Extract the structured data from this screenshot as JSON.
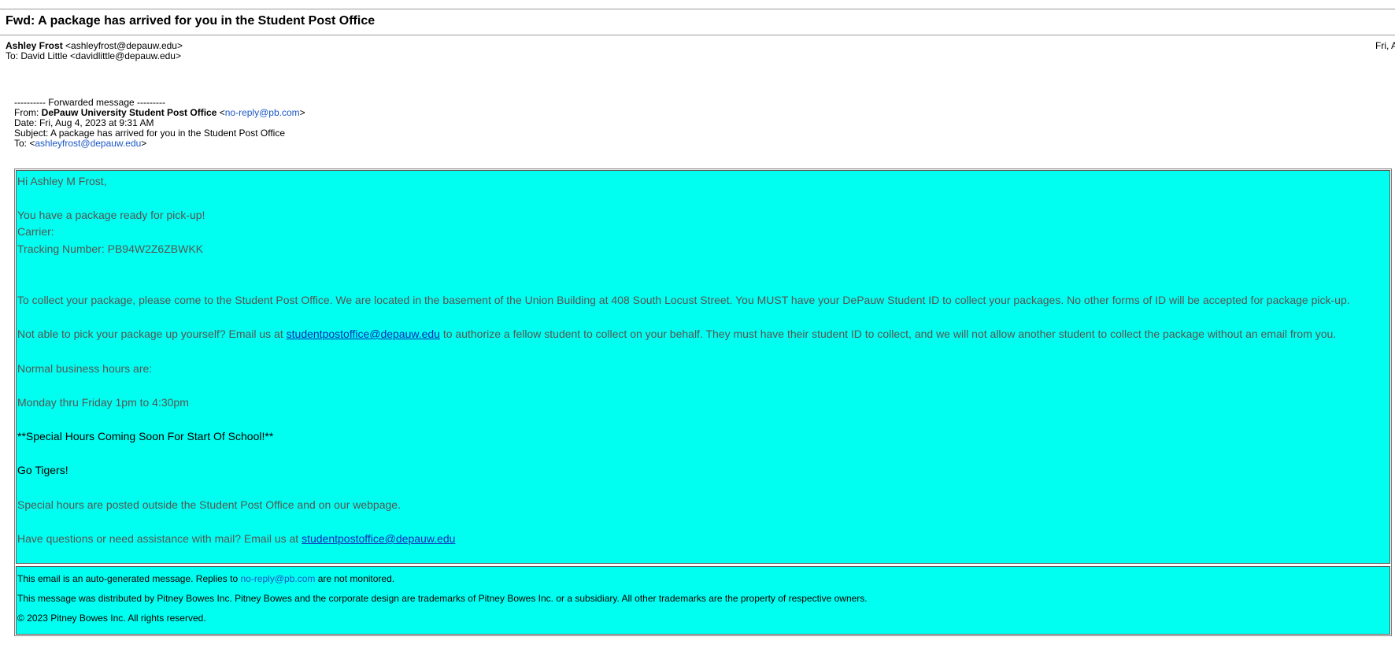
{
  "email": {
    "subject": "Fwd: A package has arrived for you in the Student Post Office",
    "from_name": "Ashley Frost",
    "from_addr": "<ashleyfrost@depauw.edu>",
    "to_line": "To: David Little <davidlittle@depauw.edu>",
    "date_short": "Fri, A"
  },
  "forwarded": {
    "separator": "---------- Forwarded message ---------",
    "from_label": "From: ",
    "from_name": "DePauw University Student Post Office",
    "from_open": " <",
    "from_email": "no-reply@pb.com",
    "from_close": ">",
    "date": "Date: Fri, Aug 4, 2023 at 9:31 AM",
    "subject": "Subject: A package has arrived for you in the Student Post Office",
    "to_label": "To: <",
    "to_email": "ashleyfrost@depauw.edu",
    "to_close": ">"
  },
  "body": {
    "greeting": "Hi Ashley M Frost,",
    "ready": "You have a package ready for pick-up!",
    "carrier": "Carrier:",
    "tracking": "Tracking Number: PB94W2Z6ZBWKK",
    "collect": "To collect your package, please come to the  Student Post Office. We are located in the basement of the Union Building at 408 South Locust Street. You MUST have your DePauw Student ID to collect your packages. No other forms of ID will be accepted for package pick-up.",
    "notable_before": "Not able to pick your package up yourself? Email us at ",
    "notable_email": "studentpostoffice@depauw.edu",
    "notable_after": " to authorize a fellow student to collect on your behalf. They must have their student ID to collect, and we will not allow another student to collect the package without an email from you.",
    "hours_label": "Normal business hours are:",
    "hours": "Monday thru Friday 1pm to 4:30pm",
    "special": "**Special Hours Coming Soon For Start Of School!**",
    "tigers": "Go Tigers!",
    "posted": "Special hours are posted outside the Student Post Office and on our webpage.",
    "questions_before": "Have questions or need assistance with mail? Email us at ",
    "questions_email": "studentpostoffice@depauw.edu"
  },
  "footer": {
    "auto_before": "This email is an auto-generated message. Replies to ",
    "auto_email": "no-reply@pb.com",
    "auto_after": " are not monitored.",
    "distributed": "This message was distributed by Pitney Bowes Inc. Pitney Bowes and the corporate design are trademarks of Pitney Bowes Inc. or a subsidiary. All other trademarks are the property of respective owners.",
    "copyright": "© 2023 Pitney Bowes Inc. All rights reserved."
  },
  "colors": {
    "panel_bg": "#00fff0",
    "link_blue": "#1a57c5",
    "body_text": "#555555"
  }
}
